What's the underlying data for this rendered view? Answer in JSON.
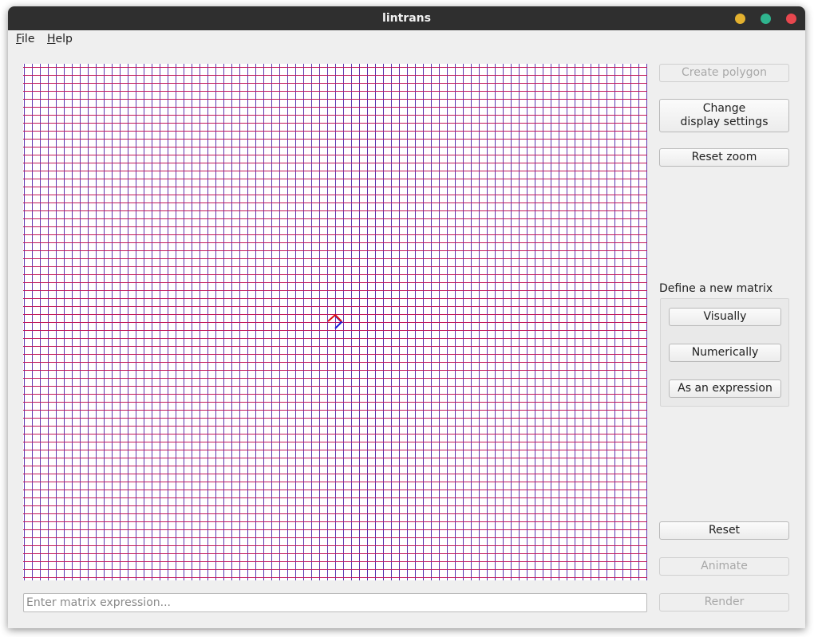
{
  "window": {
    "title": "lintrans",
    "controls": [
      "minimize",
      "maximize",
      "close"
    ],
    "control_colors": {
      "minimize": "#e3b12f",
      "maximize": "#2fb48e",
      "close": "#e8474e"
    }
  },
  "menu": {
    "file": {
      "mnemonic": "F",
      "rest": "ile"
    },
    "help": {
      "mnemonic": "H",
      "rest": "elp"
    }
  },
  "sidebar": {
    "create_polygon": "Create polygon",
    "change_display_line1": "Change",
    "change_display_line2": "display settings",
    "reset_zoom": "Reset zoom",
    "define_matrix": {
      "label": "Define a new matrix",
      "visually": "Visually",
      "numerically": "Numerically",
      "as_expression": "As an expression"
    },
    "reset": "Reset",
    "animate": "Animate",
    "render": "Render"
  },
  "expression_input": {
    "value": "",
    "placeholder": "Enter matrix expression..."
  },
  "plot": {
    "background": "#ffffff",
    "grid_colors": {
      "horizontal": "#c2185b",
      "vertical": "#5c35b0"
    },
    "basis_colors": {
      "i_hat": "#1717d9",
      "j_hat": "#e01010"
    }
  }
}
